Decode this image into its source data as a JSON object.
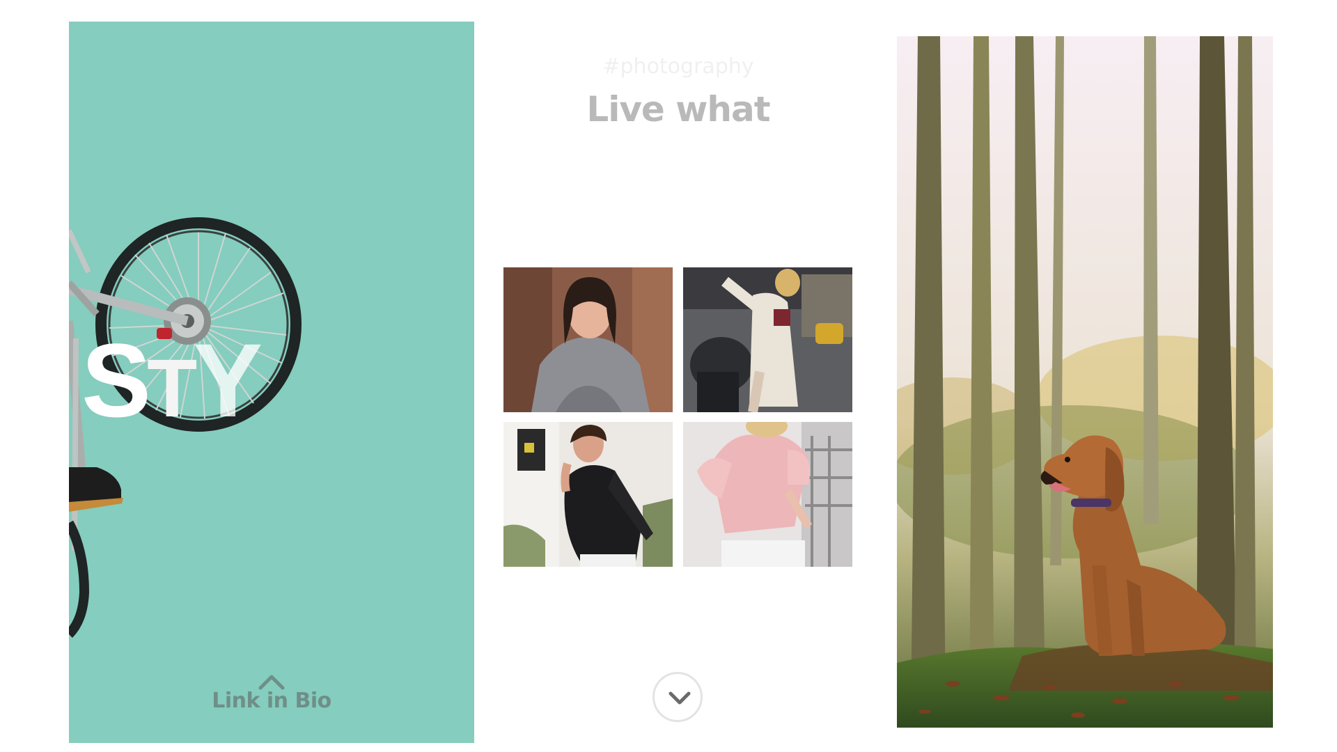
{
  "left_panel": {
    "background_color": "#85cdbe",
    "stylish_chars": [
      "S",
      "T",
      "Y"
    ],
    "link_label": "Link in Bio",
    "link_icon": "chevron-up-icon"
  },
  "middle_panel": {
    "hashtag": "#photography",
    "headline": "Live what",
    "scroll_icon": "chevron-down-icon"
  },
  "right_panel": {
    "subject": "dog-in-forest-photo"
  },
  "colors": {
    "teal": "#85cdbe",
    "headline_gray": "#b9b9b9"
  }
}
